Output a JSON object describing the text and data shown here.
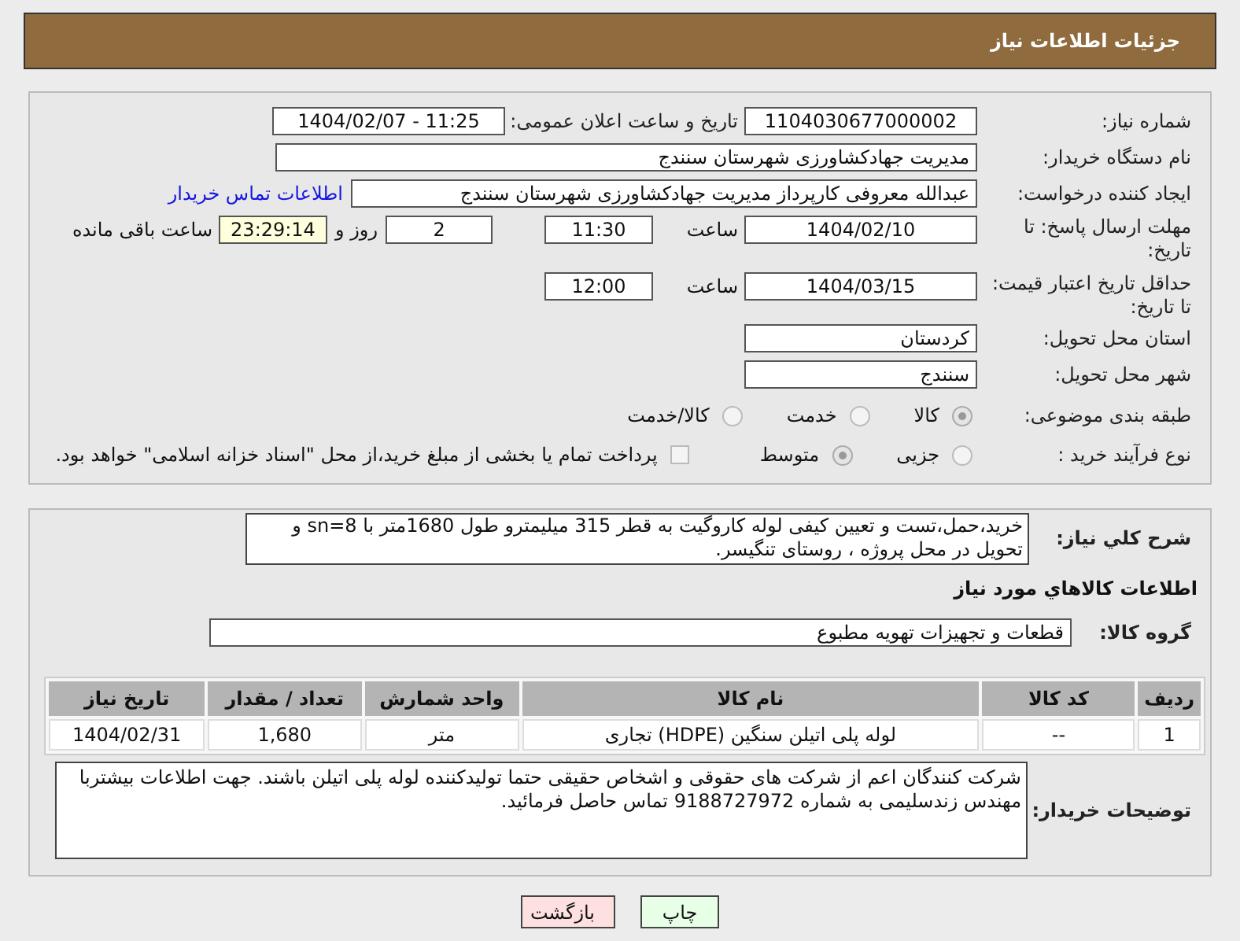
{
  "title": "جزئیات اطلاعات نیاز",
  "need_number": {
    "label": "شماره نیاز:",
    "value": "1104030677000002"
  },
  "announce": {
    "label": "تاریخ و ساعت اعلان عمومی:",
    "value": "1404/02/07 - 11:25"
  },
  "buyer_org": {
    "label": "نام دستگاه خریدار:",
    "value": "مدیریت جهادکشاورزی شهرستان سنندج"
  },
  "requester": {
    "label": "ایجاد کننده درخواست:",
    "value": "عبدالله معروفی کارپرداز مدیریت جهادکشاورزی شهرستان سنندج",
    "link": "اطلاعات تماس خریدار"
  },
  "deadline": {
    "label": "مهلت ارسال پاسخ: تا تاریخ:",
    "date": "1404/02/10",
    "time_label": "ساعت",
    "time": "11:30",
    "days": "2",
    "days_label": "روز و",
    "remaining": "23:29:14",
    "remaining_label": "ساعت باقی مانده"
  },
  "validity": {
    "label": "حداقل تاریخ اعتبار قیمت: تا تاریخ:",
    "date": "1404/03/15",
    "time_label": "ساعت",
    "time": "12:00"
  },
  "province": {
    "label": "استان محل تحویل:",
    "value": "کردستان"
  },
  "city": {
    "label": "شهر محل تحویل:",
    "value": "سنندج"
  },
  "category": {
    "label": "طبقه بندی موضوعی:",
    "options": [
      {
        "label": "کالا",
        "selected": true
      },
      {
        "label": "خدمت",
        "selected": false
      },
      {
        "label": "کالا/خدمت",
        "selected": false
      }
    ]
  },
  "process": {
    "label": "نوع فرآیند خرید :",
    "options": [
      {
        "label": "جزیی",
        "selected": false
      },
      {
        "label": "متوسط",
        "selected": true
      }
    ],
    "payment": {
      "label": "پرداخت تمام یا بخشی از مبلغ خرید،از محل \"اسناد خزانه اسلامی\" خواهد بود.",
      "checked": false
    }
  },
  "description": {
    "label": "شرح کلي نياز:",
    "value": "خرید،حمل،تست و تعیین کیفی لوله کاروگیت به قطر 315 میلیمترو طول 1680متر با sn=8 و تحویل در محل پروژه ، روستای تنگیسر."
  },
  "goods_title": "اطلاعات کالاهاي مورد نياز",
  "goods_group": {
    "label": "گروه کالا:",
    "value": "قطعات و تجهیزات تهویه مطبوع"
  },
  "table": {
    "columns": [
      "ردیف",
      "کد کالا",
      "نام کالا",
      "واحد شمارش",
      "تعداد / مقدار",
      "تاریخ نیاز"
    ],
    "rows": [
      [
        "1",
        "--",
        "لوله پلی اتیلن سنگین (HDPE) تجاری",
        "متر",
        "1,680",
        "1404/02/31"
      ]
    ]
  },
  "buyer_notes": {
    "label": "توضیحات خریدار:",
    "value": "شرکت کنندگان اعم از شرکت های حقوقی و اشخاص حقیقی حتما تولیدکننده لوله پلی اتیلن باشند. جهت اطلاعات بیشتربا مهندس زندسلیمی به شماره 9188727972 تماس حاصل فرمائید."
  },
  "buttons": [
    {
      "kind": "print",
      "label": "چاپ"
    },
    {
      "kind": "back",
      "label": "بازگشت"
    }
  ]
}
